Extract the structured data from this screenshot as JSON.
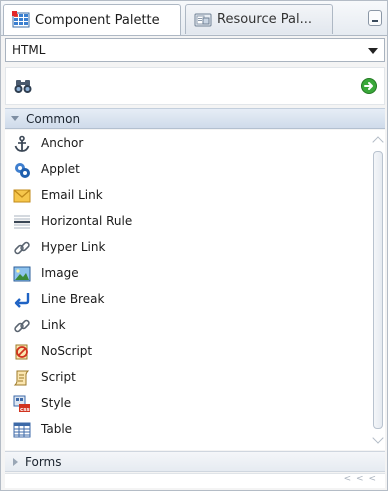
{
  "tabs": [
    {
      "label": "Component Palette",
      "icon": "component-palette-icon",
      "active": true
    },
    {
      "label": "Resource Pal...",
      "icon": "resource-palette-icon",
      "active": false
    }
  ],
  "dropdown": {
    "selected": "HTML"
  },
  "search": {
    "value": "",
    "placeholder": ""
  },
  "categories": {
    "common": {
      "label": "Common",
      "expanded": true
    },
    "forms": {
      "label": "Forms",
      "expanded": false
    }
  },
  "items": [
    {
      "label": "Anchor",
      "icon": "anchor-icon"
    },
    {
      "label": "Applet",
      "icon": "applet-icon"
    },
    {
      "label": "Email Link",
      "icon": "email-link-icon"
    },
    {
      "label": "Horizontal Rule",
      "icon": "horizontal-rule-icon"
    },
    {
      "label": "Hyper Link",
      "icon": "hyperlink-icon"
    },
    {
      "label": "Image",
      "icon": "image-icon"
    },
    {
      "label": "Line Break",
      "icon": "line-break-icon"
    },
    {
      "label": "Link",
      "icon": "link-icon"
    },
    {
      "label": "NoScript",
      "icon": "noscript-icon"
    },
    {
      "label": "Script",
      "icon": "script-icon"
    },
    {
      "label": "Style",
      "icon": "style-icon"
    },
    {
      "label": "Table",
      "icon": "table-icon"
    }
  ],
  "colors": {
    "accent": "#2e7bd0",
    "header_bg": "#dce5f0",
    "go_green": "#3aa83a"
  },
  "footer": {
    "dots": "< < <"
  }
}
